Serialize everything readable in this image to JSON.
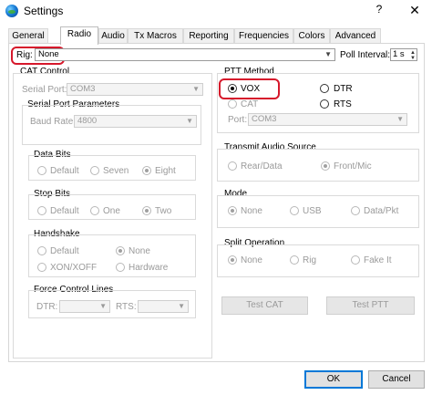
{
  "window": {
    "title": "Settings",
    "help": "?",
    "close": "✕"
  },
  "tabs": [
    "General",
    "Radio",
    "Audio",
    "Tx Macros",
    "Reporting",
    "Frequencies",
    "Colors",
    "Advanced"
  ],
  "active_tab": "Radio",
  "rig": {
    "label": "Rig:",
    "value": "None"
  },
  "poll": {
    "label": "Poll Interval:",
    "value": "1 s"
  },
  "cat": {
    "title": "CAT Control",
    "serial_label": "Serial Port:",
    "serial_value": "COM3",
    "params_title": "Serial Port Parameters",
    "baud_label": "Baud Rate:",
    "baud_value": "4800",
    "data_bits": {
      "title": "Data Bits",
      "options": [
        "Default",
        "Seven",
        "Eight"
      ],
      "selected": "Eight"
    },
    "stop_bits": {
      "title": "Stop Bits",
      "options": [
        "Default",
        "One",
        "Two"
      ],
      "selected": "Two"
    },
    "handshake": {
      "title": "Handshake",
      "options": [
        "Default",
        "None",
        "XON/XOFF",
        "Hardware"
      ],
      "selected": "None"
    },
    "force": {
      "title": "Force Control Lines",
      "dtr_label": "DTR:",
      "rts_label": "RTS:"
    }
  },
  "ptt": {
    "title": "PTT Method",
    "options": [
      "VOX",
      "DTR",
      "CAT",
      "RTS"
    ],
    "selected": "VOX",
    "port_label": "Port:",
    "port_value": "COM3"
  },
  "audio_source": {
    "title": "Transmit Audio Source",
    "options": [
      "Rear/Data",
      "Front/Mic"
    ],
    "selected": "Front/Mic"
  },
  "mode": {
    "title": "Mode",
    "options": [
      "None",
      "USB",
      "Data/Pkt"
    ],
    "selected": "None"
  },
  "split": {
    "title": "Split Operation",
    "options": [
      "None",
      "Rig",
      "Fake It"
    ],
    "selected": "None"
  },
  "buttons": {
    "test_cat": "Test CAT",
    "test_ptt": "Test PTT",
    "ok": "OK",
    "cancel": "Cancel"
  },
  "colors": {
    "highlight": "#d6182b",
    "accent": "#0078d7"
  }
}
